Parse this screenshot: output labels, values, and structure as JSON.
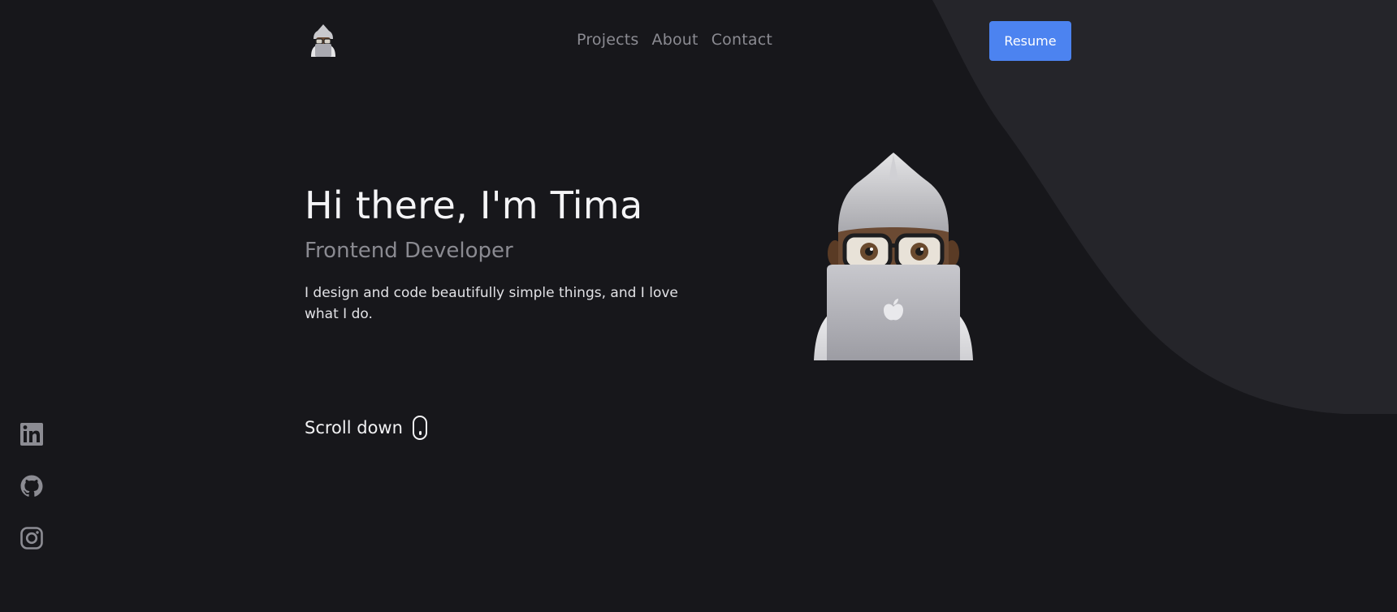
{
  "header": {
    "logo_name": "memoji-avatar",
    "nav": [
      {
        "label": "Projects"
      },
      {
        "label": "About"
      },
      {
        "label": "Contact"
      }
    ],
    "resume_label": "Resume"
  },
  "hero": {
    "title": "Hi there, I'm Tima",
    "subtitle": "Frontend Developer",
    "description": "I design and code beautifully simple things, and I love what I do.",
    "scroll_label": "Scroll down"
  },
  "social": [
    {
      "icon": "linkedin-icon"
    },
    {
      "icon": "github-icon"
    },
    {
      "icon": "instagram-icon"
    }
  ],
  "colors": {
    "background": "#17171b",
    "wave": "#25252a",
    "accent": "#4c83f0",
    "nav_text": "#8b8b92",
    "subtitle": "#8a8a91"
  }
}
